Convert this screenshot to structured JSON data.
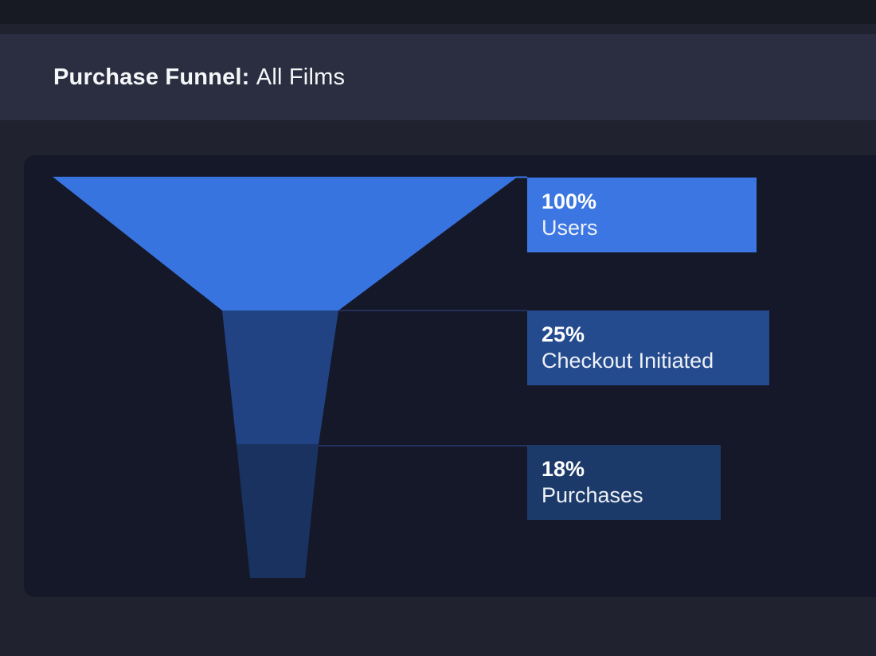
{
  "header": {
    "title_bold": "Purchase Funnel:",
    "title_regular": "All Films"
  },
  "chart_data": {
    "type": "funnel",
    "title": "Purchase Funnel: All Films",
    "orientation": "vertical-descending",
    "legend": "none",
    "stages": [
      {
        "label": "Users",
        "percent_label": "100%",
        "value_pct": 100,
        "segment_color": "#3874df",
        "label_bg": "#3b76e3"
      },
      {
        "label": "Checkout Initiated",
        "percent_label": "25%",
        "value_pct": 25,
        "segment_color": "#224383",
        "label_bg": "#254b8f"
      },
      {
        "label": "Purchases",
        "percent_label": "18%",
        "value_pct": 18,
        "segment_color": "#19325f",
        "label_bg": "#1c3a69"
      }
    ]
  },
  "colors": {
    "page_background": "#20222f",
    "top_strip": "#171a23",
    "header_band": "#2b2e41",
    "card_background": "#151829",
    "connector_dark": "#22305a",
    "connector_bright": "#3b76e3",
    "title_text": "#f6f7f9",
    "label_text": "#ffffff"
  }
}
